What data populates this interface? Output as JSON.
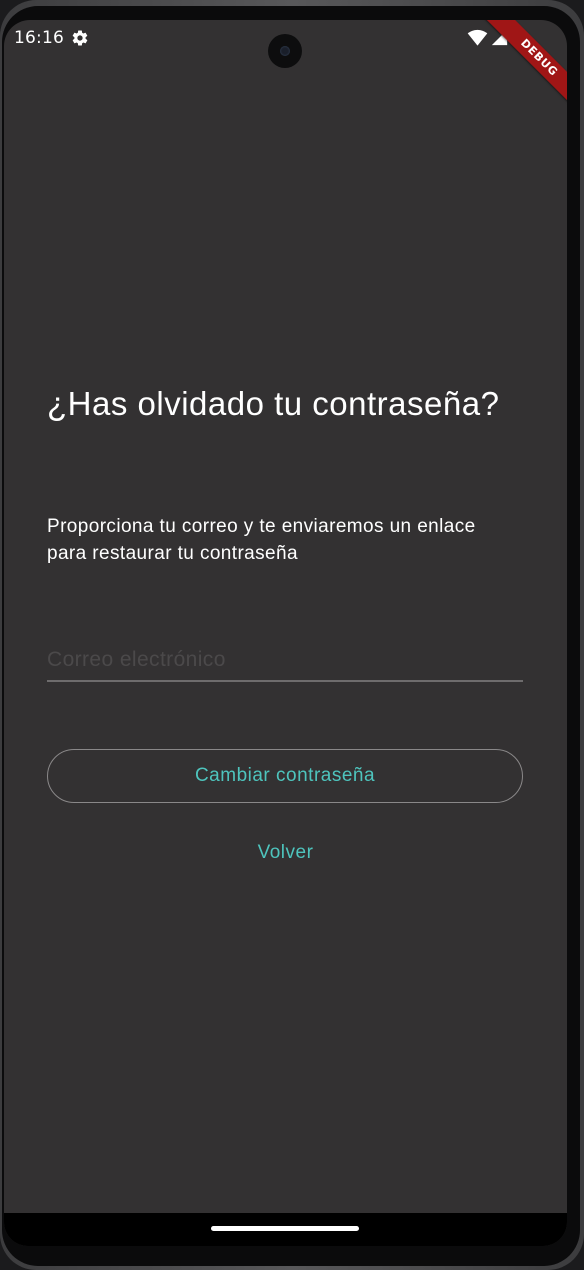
{
  "status_bar": {
    "time": "16:16",
    "icons": [
      "gear-icon",
      "wifi-icon",
      "signal-icon"
    ]
  },
  "debug_banner": {
    "label": "DEBUG",
    "color": "#a01616"
  },
  "forgot_password": {
    "title": "¿Has olvidado tu contraseña?",
    "description": "Proporciona tu correo y te enviaremos un enlace para restaurar tu contraseña",
    "email_field": {
      "value": "",
      "placeholder": "Correo electrónico"
    },
    "submit_label": "Cambiar contraseña",
    "back_label": "Volver"
  },
  "colors": {
    "background": "#333132",
    "accent": "#4ec4bd",
    "text": "#ffffff"
  }
}
